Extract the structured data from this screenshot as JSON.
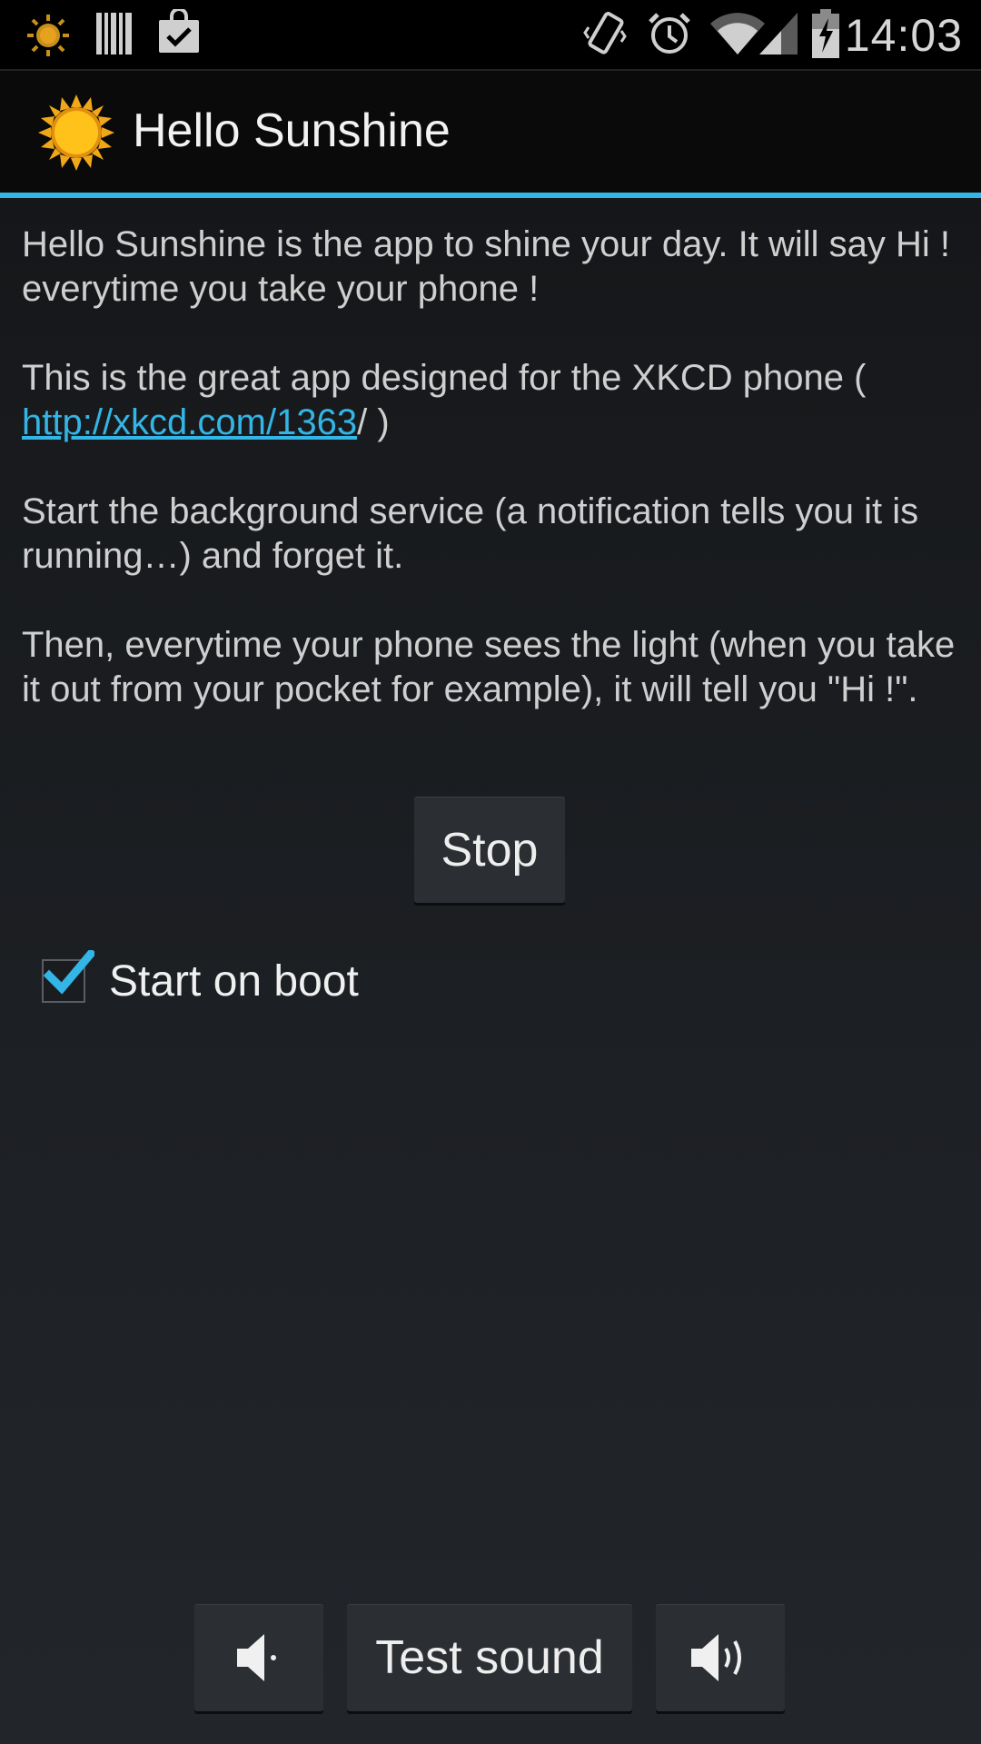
{
  "status_bar": {
    "time": "14:03",
    "left_icons": [
      "sun-notification-icon",
      "barcode-icon",
      "shopping-bag-check-icon"
    ],
    "right_icons": [
      "vibrate-icon",
      "alarm-icon",
      "wifi-icon",
      "signal-icon",
      "battery-charging-icon"
    ]
  },
  "action_bar": {
    "title": "Hello Sunshine",
    "icon": "sun-icon",
    "accent_color": "#33b5e5"
  },
  "content": {
    "p1": "Hello Sunshine is the app to shine your day. It will say Hi ! everytime you take your phone !",
    "p2_before": "This is the great app designed for the XKCD phone ( ",
    "p2_link": "http://xkcd.com/1363",
    "p2_after": "/ )",
    "p3": "Start the background service (a notification tells you it is running…) and forget it.",
    "p4": "Then, everytime your phone sees the light (when you take it out from your pocket for example), it will tell you \"Hi !\"."
  },
  "controls": {
    "stop_label": "Stop",
    "start_on_boot_label": "Start on boot",
    "start_on_boot_checked": true,
    "test_sound_label": "Test sound",
    "volume_down_icon": "volume-down-icon",
    "volume_up_icon": "volume-up-icon"
  }
}
